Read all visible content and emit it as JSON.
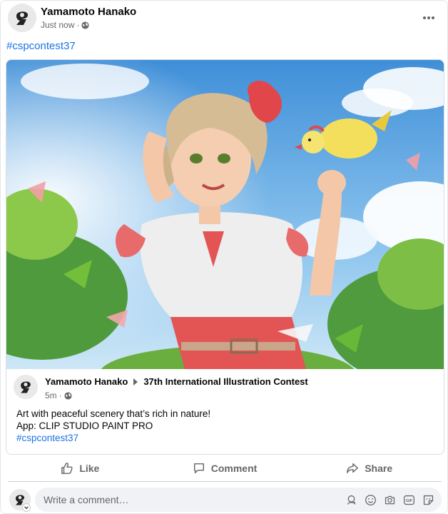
{
  "post": {
    "author": "Yamamoto Hanako",
    "time": "Just now",
    "separator": "·",
    "privacy_icon": "globe-icon",
    "hashtag": "#cspcontest37"
  },
  "shared": {
    "author": "Yamamoto Hanako",
    "target": "37th International Illustration Contest",
    "time": "5m",
    "separator": "·",
    "privacy_icon": "globe-icon",
    "lines": [
      "Art with peaceful scenery that’s rich in nature!",
      "App: CLIP STUDIO PAINT PRO"
    ],
    "hashtag": "#cspcontest37"
  },
  "actions": {
    "like": "Like",
    "comment": "Comment",
    "share": "Share"
  },
  "comment_box": {
    "placeholder": "Write a comment…",
    "tools": [
      "avatar-sticker-icon",
      "emoji-icon",
      "camera-icon",
      "gif-icon",
      "sticker-icon"
    ],
    "gif_label": "GIF"
  },
  "colors": {
    "link": "#1b74e4",
    "muted": "#65676b"
  }
}
